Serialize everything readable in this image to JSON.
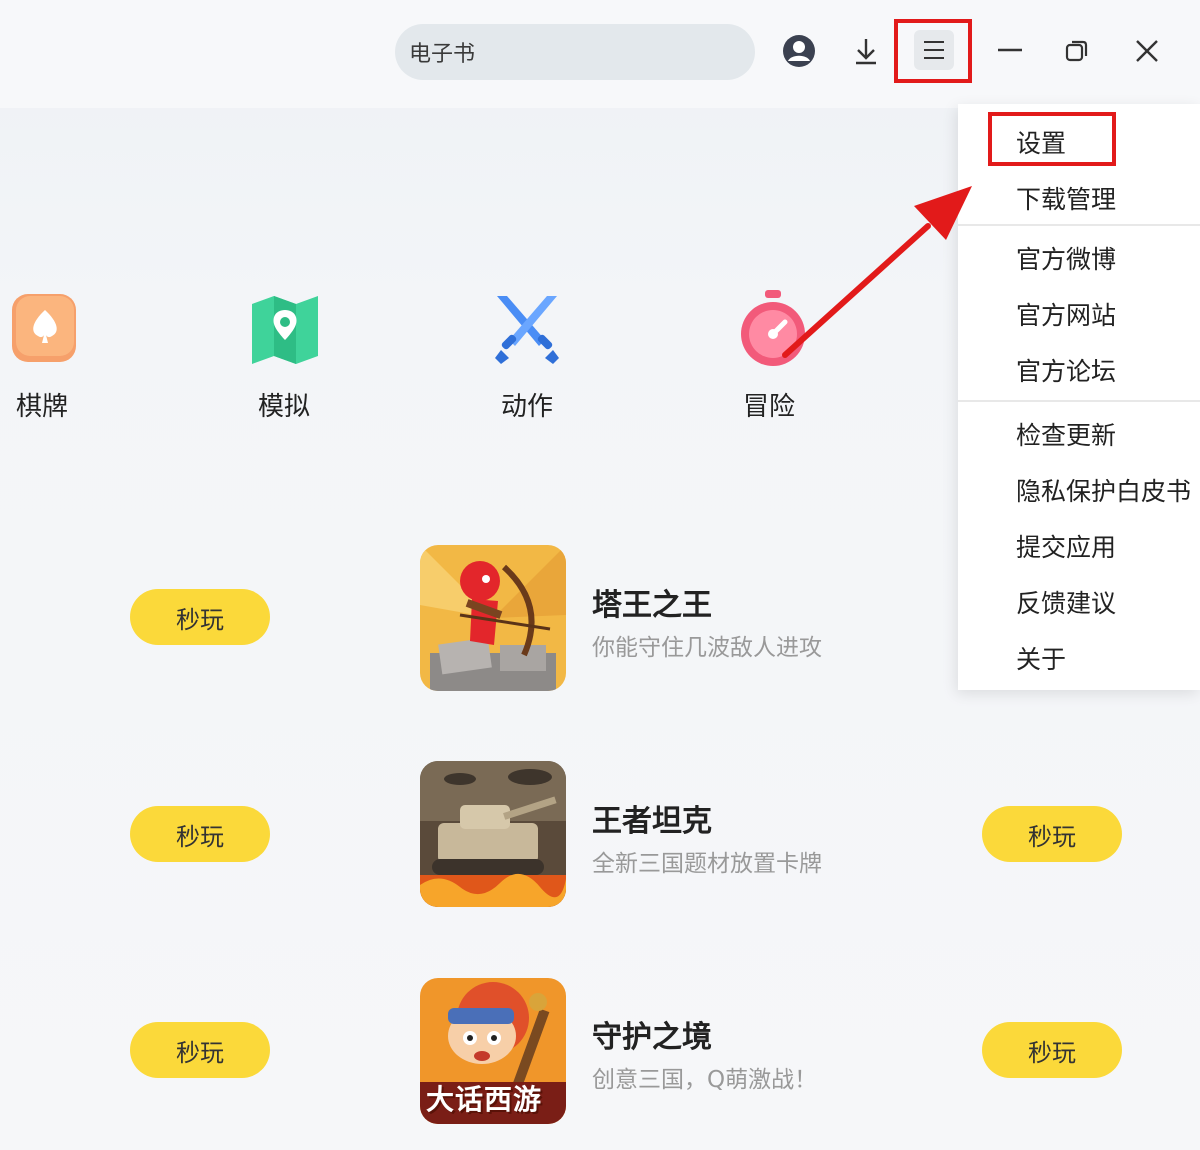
{
  "search": {
    "text": "电子书"
  },
  "toolbar": {
    "icons": [
      "user-icon",
      "download-icon",
      "menu-icon",
      "minimize-icon",
      "restore-icon",
      "close-icon"
    ]
  },
  "categories": [
    {
      "label": "棋牌",
      "icon": "spade-icon"
    },
    {
      "label": "模拟",
      "icon": "map-pin-icon"
    },
    {
      "label": "动作",
      "icon": "crossed-swords-icon"
    },
    {
      "label": "冒险",
      "icon": "stopwatch-icon"
    }
  ],
  "games": [
    {
      "title": "塔王之王",
      "desc": "你能守住几波敌人进攻",
      "play": "秒玩"
    },
    {
      "title": "王者坦克",
      "desc": "全新三国题材放置卡牌",
      "play": "秒玩"
    },
    {
      "title": "守护之境",
      "desc": "创意三国，Q萌激战！",
      "play": "秒玩"
    }
  ],
  "left_play_buttons": [
    "秒玩",
    "秒玩",
    "秒玩"
  ],
  "right_play_buttons": [
    "秒玩",
    "秒玩"
  ],
  "menu": {
    "items": [
      "设置",
      "下载管理",
      "官方微博",
      "官方网站",
      "官方论坛",
      "检查更新",
      "隐私保护白皮书",
      "提交应用",
      "反馈建议",
      "关于"
    ]
  },
  "thumb_text": {
    "game3_logo": "大话西游"
  },
  "colors": {
    "play_button": "#fbd93a",
    "highlight": "#e21a1a",
    "search_bg": "#e3e8ec"
  }
}
